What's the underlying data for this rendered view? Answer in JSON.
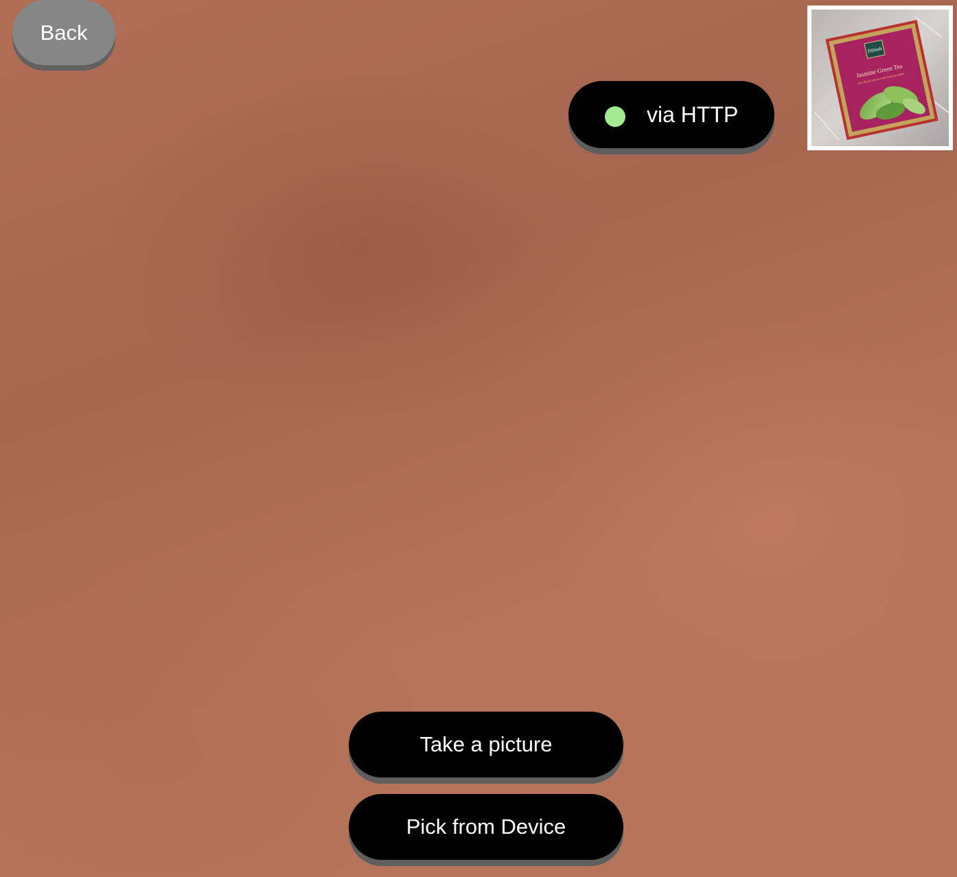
{
  "back_button": {
    "label": "Back"
  },
  "connection": {
    "label": "via HTTP",
    "status_color": "#a4ea93"
  },
  "thumbnail": {
    "icon": "tea-packet-photo-thumbnail",
    "brand": "Dilmah",
    "product": "Jasmine Green Tea",
    "tagline": "soft, floral aromas with Jasmine petals"
  },
  "actions": {
    "take_picture": "Take a picture",
    "pick_from_device": "Pick from Device"
  },
  "colors": {
    "button_primary": "#000000",
    "button_secondary": "#868686",
    "background": "#b06e55"
  }
}
